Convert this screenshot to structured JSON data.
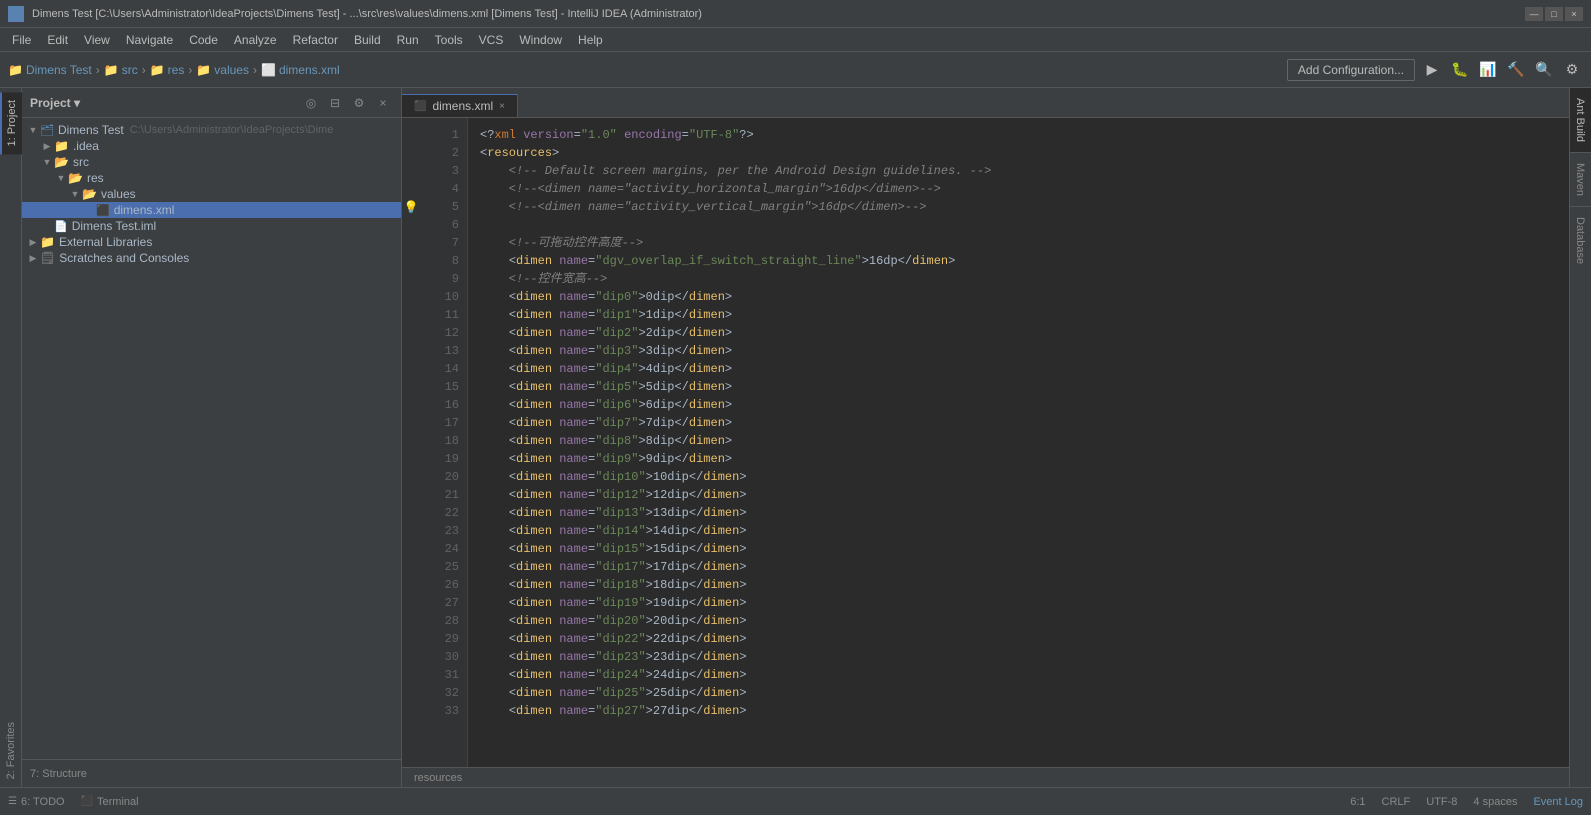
{
  "titleBar": {
    "title": "Dimens Test [C:\\Users\\Administrator\\IdeaProjects\\Dimens Test] - ...\\src\\res\\values\\dimens.xml [Dimens Test] - IntelliJ IDEA (Administrator)",
    "controls": [
      "—",
      "□",
      "×"
    ]
  },
  "menuBar": {
    "items": [
      "File",
      "Edit",
      "View",
      "Navigate",
      "Code",
      "Analyze",
      "Refactor",
      "Build",
      "Run",
      "Tools",
      "VCS",
      "Window",
      "Help"
    ]
  },
  "toolbar": {
    "breadcrumbs": [
      "Dimens Test",
      "src",
      "res",
      "values",
      "dimens.xml"
    ],
    "addConfigLabel": "Add Configuration...",
    "icons": [
      "▶",
      "⏸",
      "⏹",
      "🔨",
      "🔍",
      "⚙"
    ]
  },
  "sidebar": {
    "panelTitle": "Project",
    "tree": [
      {
        "label": "Dimens Test",
        "indent": 0,
        "type": "project",
        "path": "C:\\Users\\Administrator\\IdeaProjects\\Dimens",
        "expanded": true
      },
      {
        "label": ".idea",
        "indent": 1,
        "type": "folder",
        "expanded": false
      },
      {
        "label": "src",
        "indent": 1,
        "type": "folder",
        "expanded": true
      },
      {
        "label": "res",
        "indent": 2,
        "type": "folder",
        "expanded": true
      },
      {
        "label": "values",
        "indent": 3,
        "type": "folder",
        "expanded": true
      },
      {
        "label": "dimens.xml",
        "indent": 4,
        "type": "xml",
        "selected": true
      },
      {
        "label": "Dimens Test.iml",
        "indent": 1,
        "type": "iml"
      },
      {
        "label": "External Libraries",
        "indent": 0,
        "type": "folder",
        "expanded": false
      },
      {
        "label": "Scratches and Consoles",
        "indent": 0,
        "type": "folder",
        "expanded": false
      }
    ]
  },
  "editorTabs": [
    {
      "label": "dimens.xml",
      "active": true
    }
  ],
  "codeLines": [
    {
      "num": 1,
      "content": "xml_decl",
      "raw": "<?xml version=\"1.0\" encoding=\"UTF-8\"?>"
    },
    {
      "num": 2,
      "content": "tag_open",
      "raw": "<resources>"
    },
    {
      "num": 3,
      "content": "comment",
      "raw": "    <!-- Default screen margins, per the Android Design guidelines. -->"
    },
    {
      "num": 4,
      "content": "comment",
      "raw": "    <!--<dimen name=\"activity_horizontal_margin\">16dp</dimen>-->"
    },
    {
      "num": 5,
      "content": "comment_bulb",
      "raw": "    <!--<dimen name=\"activity_vertical_margin\">16dp</dimen>-->"
    },
    {
      "num": 6,
      "content": "empty",
      "raw": ""
    },
    {
      "num": 7,
      "content": "comment",
      "raw": "    <!--可拖动控件高度-->"
    },
    {
      "num": 8,
      "content": "dimen",
      "raw": "    <dimen name=\"dgv_overlap_if_switch_straight_line\">16dp</dimen>"
    },
    {
      "num": 9,
      "content": "comment",
      "raw": "    <!--控件宽高-->"
    },
    {
      "num": 10,
      "content": "dimen",
      "raw": "    <dimen name=\"dip0\">0dip</dimen>"
    },
    {
      "num": 11,
      "content": "dimen",
      "raw": "    <dimen name=\"dip1\">1dip</dimen>"
    },
    {
      "num": 12,
      "content": "dimen",
      "raw": "    <dimen name=\"dip2\">2dip</dimen>"
    },
    {
      "num": 13,
      "content": "dimen",
      "raw": "    <dimen name=\"dip3\">3dip</dimen>"
    },
    {
      "num": 14,
      "content": "dimen",
      "raw": "    <dimen name=\"dip4\">4dip</dimen>"
    },
    {
      "num": 15,
      "content": "dimen",
      "raw": "    <dimen name=\"dip5\">5dip</dimen>"
    },
    {
      "num": 16,
      "content": "dimen",
      "raw": "    <dimen name=\"dip6\">6dip</dimen>"
    },
    {
      "num": 17,
      "content": "dimen",
      "raw": "    <dimen name=\"dip7\">7dip</dimen>"
    },
    {
      "num": 18,
      "content": "dimen",
      "raw": "    <dimen name=\"dip8\">8dip</dimen>"
    },
    {
      "num": 19,
      "content": "dimen",
      "raw": "    <dimen name=\"dip9\">9dip</dimen>"
    },
    {
      "num": 20,
      "content": "dimen",
      "raw": "    <dimen name=\"dip10\">10dip</dimen>"
    },
    {
      "num": 21,
      "content": "dimen",
      "raw": "    <dimen name=\"dip12\">12dip</dimen>"
    },
    {
      "num": 22,
      "content": "dimen",
      "raw": "    <dimen name=\"dip13\">13dip</dimen>"
    },
    {
      "num": 23,
      "content": "dimen",
      "raw": "    <dimen name=\"dip14\">14dip</dimen>"
    },
    {
      "num": 24,
      "content": "dimen",
      "raw": "    <dimen name=\"dip15\">15dip</dimen>"
    },
    {
      "num": 25,
      "content": "dimen",
      "raw": "    <dimen name=\"dip17\">17dip</dimen>"
    },
    {
      "num": 26,
      "content": "dimen",
      "raw": "    <dimen name=\"dip18\">18dip</dimen>"
    },
    {
      "num": 27,
      "content": "dimen",
      "raw": "    <dimen name=\"dip19\">19dip</dimen>"
    },
    {
      "num": 28,
      "content": "dimen",
      "raw": "    <dimen name=\"dip20\">20dip</dimen>"
    },
    {
      "num": 29,
      "content": "dimen",
      "raw": "    <dimen name=\"dip22\">22dip</dimen>"
    },
    {
      "num": 30,
      "content": "dimen",
      "raw": "    <dimen name=\"dip23\">23dip</dimen>"
    },
    {
      "num": 31,
      "content": "dimen",
      "raw": "    <dimen name=\"dip24\">24dip</dimen>"
    },
    {
      "num": 32,
      "content": "dimen",
      "raw": "    <dimen name=\"dip25\">25dip</dimen>"
    },
    {
      "num": 33,
      "content": "dimen",
      "raw": "    <dimen name=\"dip27\">27dip</dimen>"
    }
  ],
  "statusBar": {
    "tabs": [
      "6: TODO",
      "Terminal"
    ],
    "position": "6:1",
    "lineEnding": "CRLF",
    "encoding": "UTF-8",
    "indent": "4 spaces",
    "eventLog": "Event Log"
  },
  "rightPanels": [
    "Ant Build",
    "Maven",
    "Database"
  ],
  "leftTabs": [
    "1: Project"
  ],
  "bottomTabs": [
    "2: Favorites",
    "7: Structure"
  ]
}
